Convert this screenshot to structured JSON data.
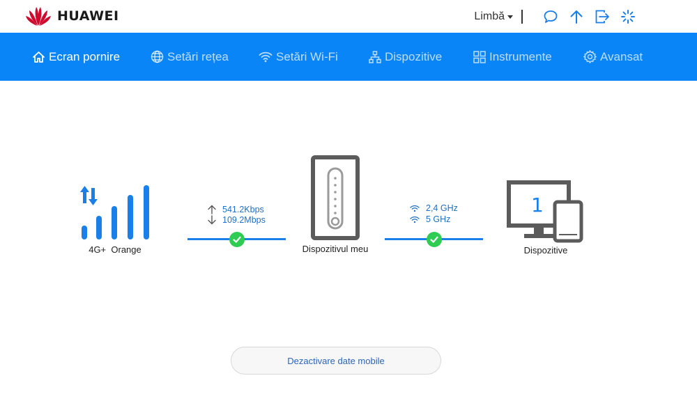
{
  "brand": {
    "name": "HUAWEI",
    "color": "#cf0a2c"
  },
  "header": {
    "language_label": "Limbă",
    "icons": [
      "message-icon",
      "update-arrow-icon",
      "logout-icon",
      "loading-spinner-icon"
    ]
  },
  "nav": {
    "accent": "#0a85f7",
    "items": [
      {
        "label": "Ecran pornire",
        "icon": "home-icon",
        "active": true
      },
      {
        "label": "Setări rețea",
        "icon": "globe-icon",
        "active": false
      },
      {
        "label": "Setări Wi-Fi",
        "icon": "wifi-icon",
        "active": false
      },
      {
        "label": "Dispozitive",
        "icon": "network-tree-icon",
        "active": false
      },
      {
        "label": "Instrumente",
        "icon": "grid-tools-icon",
        "active": false
      },
      {
        "label": "Avansat",
        "icon": "gear-icon",
        "active": false
      }
    ]
  },
  "status": {
    "network_type": "4G+",
    "operator": "Orange",
    "upload_speed": "541.2Kbps",
    "download_speed": "109.2Mbps",
    "router_label": "Dispozitivul meu",
    "wifi_band_1": "2,4 GHz",
    "wifi_band_2": "5 GHz",
    "device_count": "1",
    "devices_label": "Dispozitive",
    "connection_color": "#2ecc52"
  },
  "actions": {
    "disable_mobile_data": "Dezactivare date mobile"
  }
}
